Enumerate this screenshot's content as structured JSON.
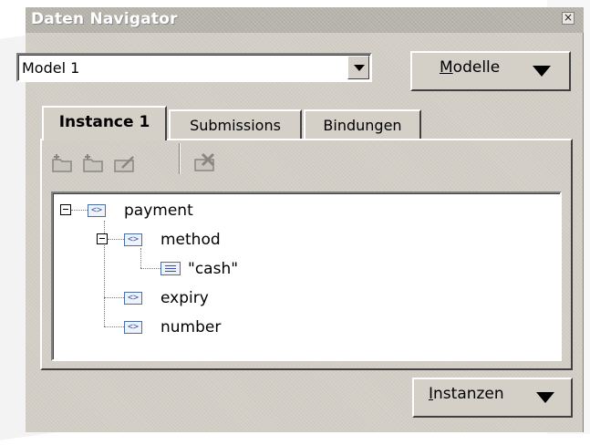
{
  "window": {
    "title": "Daten Navigator",
    "close_glyph": "×"
  },
  "model_select": {
    "value": "Model 1"
  },
  "buttons": {
    "models": {
      "mnemonic": "M",
      "rest": "odelle"
    },
    "instances": {
      "mnemonic": "I",
      "rest": "nstanzen"
    }
  },
  "tabs": [
    {
      "label": "Instance 1",
      "active": true
    },
    {
      "label": "Submissions",
      "active": false
    },
    {
      "label": "Bindungen",
      "active": false
    }
  ],
  "toolbar": [
    "add-item-icon",
    "add-element-icon",
    "edit-icon",
    "delete-icon"
  ],
  "tree": {
    "root": {
      "label": "payment"
    },
    "method": {
      "label": "method"
    },
    "value": {
      "label": "\"cash\""
    },
    "expiry": {
      "label": "expiry"
    },
    "number": {
      "label": "number"
    }
  },
  "element_icon_glyph": "<>"
}
